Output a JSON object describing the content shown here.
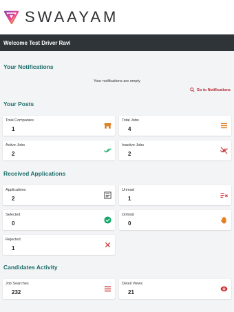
{
  "brand": {
    "name": "SWAAYAM"
  },
  "welcome": "Welcome Test Driver Ravi",
  "notifications": {
    "title": "Your Notifications",
    "empty_message": "Your notifications are empty",
    "link_label": "Go to Notifications"
  },
  "posts": {
    "title": "Your Posts",
    "cards": [
      {
        "label": "Total Companies",
        "value": "1",
        "icon": "store-icon",
        "color": "#d9730d"
      },
      {
        "label": "Total Jobs",
        "value": "4",
        "icon": "list-icon",
        "color": "#d9730d"
      },
      {
        "label": "Active Jobs",
        "value": "2",
        "icon": "double-check-icon",
        "color": "#12a86a"
      },
      {
        "label": "Inactive Jobs",
        "value": "2",
        "icon": "remove-done-icon",
        "color": "#c62828"
      }
    ]
  },
  "applications": {
    "title": "Received Applications",
    "cards": [
      {
        "label": "Applications",
        "value": "2",
        "icon": "document-list-icon",
        "color": "#333333"
      },
      {
        "label": "Unread",
        "value": "1",
        "icon": "list-clear-icon",
        "color": "#c62828"
      },
      {
        "label": "Selected",
        "value": "0",
        "icon": "check-circle-icon",
        "color": "#12a86a"
      },
      {
        "label": "Onhold",
        "value": "0",
        "icon": "hand-icon",
        "color": "#e67e22"
      },
      {
        "label": "Rejected",
        "value": "1",
        "icon": "close-icon",
        "color": "#c62828"
      }
    ]
  },
  "activity": {
    "title": "Candidates Activity",
    "cards": [
      {
        "label": "Job Searches",
        "value": "232",
        "icon": "list-icon",
        "color": "#c62828"
      },
      {
        "label": "Detail Views",
        "value": "21",
        "icon": "eye-icon",
        "color": "#c62828"
      }
    ]
  }
}
